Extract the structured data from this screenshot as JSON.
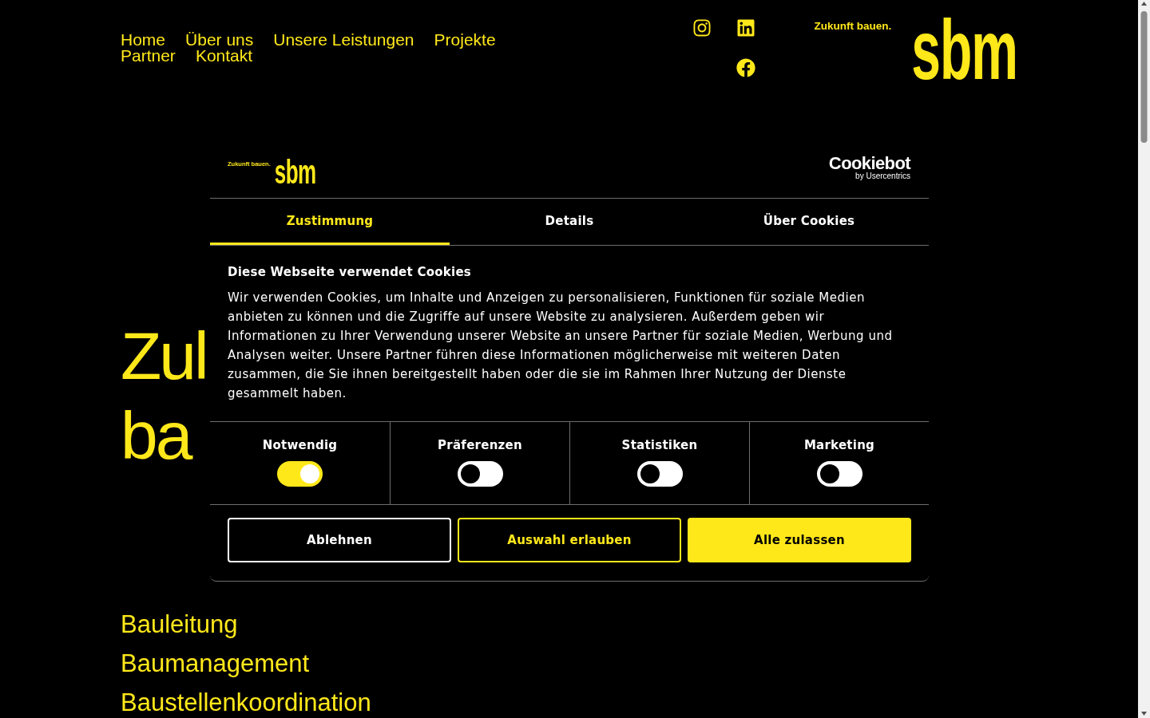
{
  "nav": [
    "Home",
    "Über uns",
    "Unsere Leistungen",
    "Projekte",
    "Partner",
    "Kontakt"
  ],
  "brand": {
    "tagline": "Zukunft bauen.",
    "wordmark": "sbm"
  },
  "hero": {
    "heading_lines": [
      "Zul",
      "ba"
    ]
  },
  "services": [
    "Bauleitung",
    "Baumanagement",
    "Baustellenkoordination"
  ],
  "cookie_dialog": {
    "brand": {
      "tagline": "Zukunft bauen.",
      "wordmark": "sbm"
    },
    "provider": {
      "name": "Cookiebot",
      "byline": "by Usercentrics"
    },
    "tabs": [
      {
        "label": "Zustimmung",
        "selected": true
      },
      {
        "label": "Details",
        "selected": false
      },
      {
        "label": "Über Cookies",
        "selected": false
      }
    ],
    "title": "Diese Webseite verwendet Cookies",
    "text": "Wir verwenden Cookies, um Inhalte und Anzeigen zu personalisieren, Funktionen für soziale Medien anbieten zu können und die Zugriffe auf unsere Website zu analysieren. Außerdem geben wir Informationen zu Ihrer Verwendung unserer Website an unsere Partner für soziale Medien, Werbung und Analysen weiter. Unsere Partner führen diese Informationen möglicherweise mit weiteren Daten zusammen, die Sie ihnen bereitgestellt haben oder die sie im Rahmen Ihrer Nutzung der Dienste gesammelt haben.",
    "categories": [
      {
        "label": "Notwendig",
        "on": true
      },
      {
        "label": "Präferenzen",
        "on": false
      },
      {
        "label": "Statistiken",
        "on": false
      },
      {
        "label": "Marketing",
        "on": false
      }
    ],
    "buttons": [
      {
        "label": "Ablehnen",
        "kind": "outline"
      },
      {
        "label": "Auswahl erlauben",
        "kind": "accent"
      },
      {
        "label": "Alle zulassen",
        "kind": "primary"
      }
    ]
  }
}
